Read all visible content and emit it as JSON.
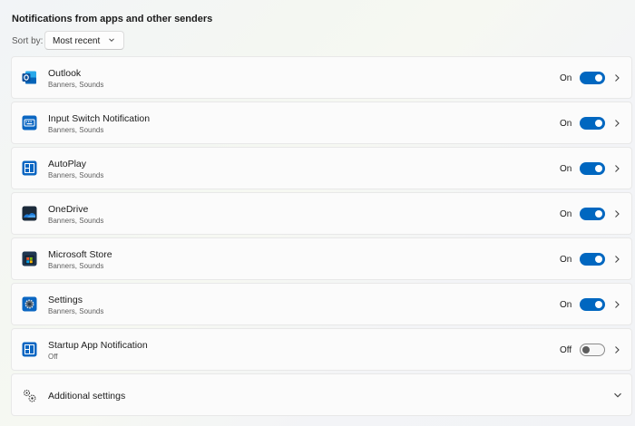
{
  "section": {
    "title": "Notifications from apps and other senders",
    "sort_label": "Sort by:",
    "sort_value": "Most recent"
  },
  "apps": [
    {
      "name": "Outlook",
      "subtitle": "Banners, Sounds",
      "state": "On",
      "icon": "outlook-icon",
      "enabled": true
    },
    {
      "name": "Input Switch Notification",
      "subtitle": "Banners, Sounds",
      "state": "On",
      "icon": "keyboard-icon",
      "enabled": true
    },
    {
      "name": "AutoPlay",
      "subtitle": "Banners, Sounds",
      "state": "On",
      "icon": "autoplay-icon",
      "enabled": true
    },
    {
      "name": "OneDrive",
      "subtitle": "Banners, Sounds",
      "state": "On",
      "icon": "onedrive-icon",
      "enabled": true
    },
    {
      "name": "Microsoft Store",
      "subtitle": "Banners, Sounds",
      "state": "On",
      "icon": "store-icon",
      "enabled": true
    },
    {
      "name": "Settings",
      "subtitle": "Banners, Sounds",
      "state": "On",
      "icon": "settings-gear-icon",
      "enabled": true
    },
    {
      "name": "Startup App Notification",
      "subtitle": "Off",
      "state": "Off",
      "icon": "startup-app-icon",
      "enabled": false
    }
  ],
  "additional": {
    "label": "Additional settings",
    "icon": "gears-icon"
  },
  "colors": {
    "accent": "#0067c0",
    "card_bg": "#fbfbfb"
  }
}
